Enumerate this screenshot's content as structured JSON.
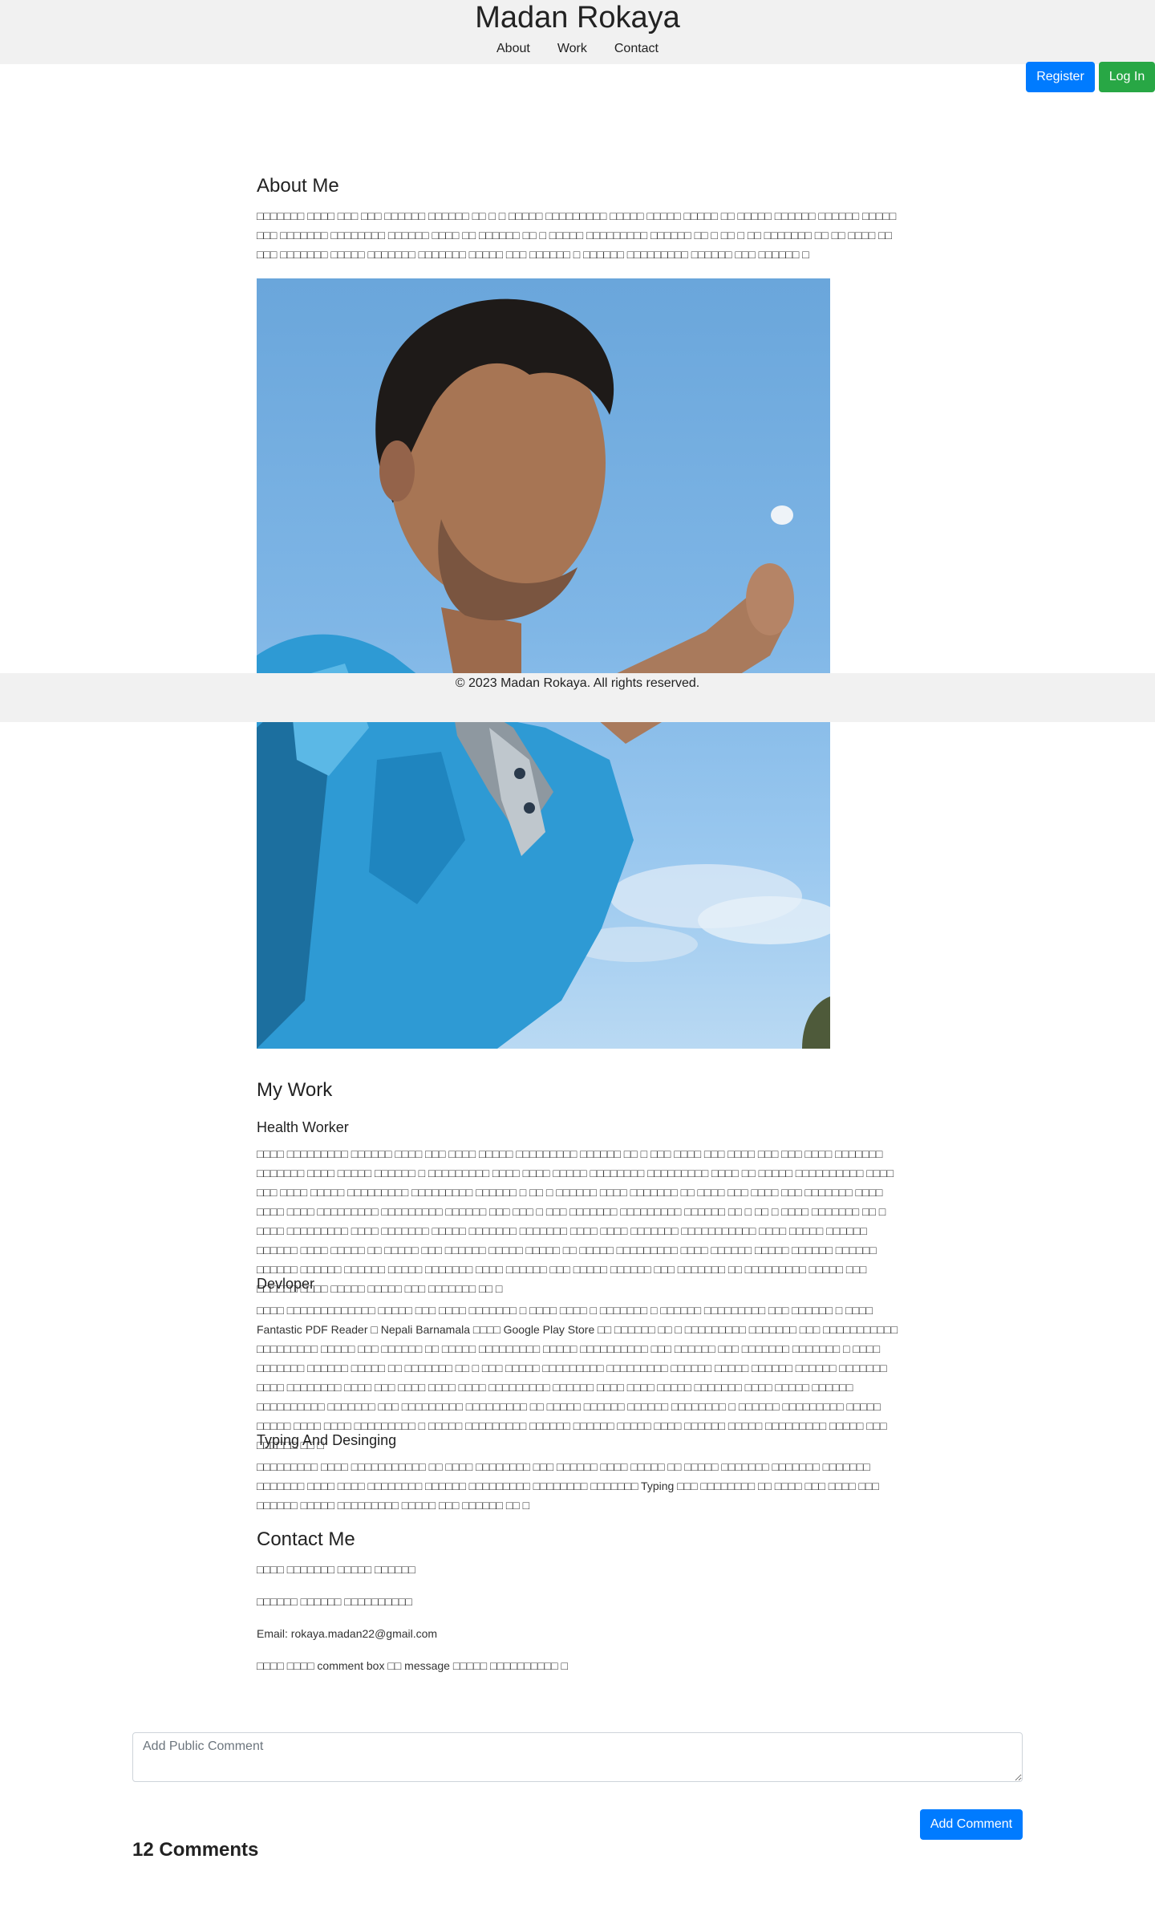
{
  "header": {
    "title": "Madan Rokaya",
    "nav": [
      "About",
      "Work",
      "Contact"
    ]
  },
  "auth": {
    "register": "Register",
    "login": "Log In"
  },
  "about": {
    "heading": "About Me",
    "text": "□□□□□□□ □□□□ □□□ □□□ □□□□□□ □□□□□□ □□ □ □ □□□□□ □□□□□□□□□ □□□□□ □□□□□ □□□□□ □□ □□□□□ □□□□□□ □□□□□□ □□□□□ □□□ □□□□□□□ □□□□□□□□ □□□□□□ □□□□ □□ □□□□□□ □□ □ □□□□□ □□□□□□□□□ □□□□□□ □□ □ □□ □ □□ □□□□□□□ □□ □□ □□□□ □□ □□□ □□□□□□□ □□□□□ □□□□□□□ □□□□□□□ □□□□□ □□□ □□□□□□ □ □□□□□□ □□□□□□□□□ □□□□□□ □□□ □□□□□□ □"
  },
  "work": {
    "heading": "My Work",
    "items": [
      {
        "title": "Health Worker",
        "text": "□□□□ □□□□□□□□□ □□□□□□ □□□□ □□□ □□□□ □□□□□ □□□□□□□□□ □□□□□□ □□ □ □□□ □□□□ □□□ □□□□ □□□ □□□ □□□□ □□□□□□□ □□□□□□□ □□□□ □□□□□ □□□□□□ □ □□□□□□□□□ □□□□ □□□□ □□□□□ □□□□□□□□ □□□□□□□□□ □□□□ □□ □□□□□ □□□□□□□□□□ □□□□ □□□ □□□□ □□□□□ □□□□□□□□□ □□□□□□□□□ □□□□□□ □ □□ □ □□□□□□ □□□□ □□□□□□□ □□ □□□□ □□□ □□□□ □□□ □□□□□□□ □□□□ □□□□ □□□□ □□□□□□□□□ □□□□□□□□□ □□□□□□ □□□ □□□ □ □□□ □□□□□□□ □□□□□□□□□ □□□□□□ □□ □ □□ □ □□□□ □□□□□□□ □□ □ □□□□ □□□□□□□□□ □□□□ □□□□□□□ □□□□□ □□□□□□□ □□□□□□□ □□□□ □□□□ □□□□□□□ □□□□□□□□□□□ □□□□ □□□□□ □□□□□□ □□□□□□ □□□□ □□□□□ □□ □□□□□ □□□ □□□□□□ □□□□□ □□□□□ □□ □□□□□ □□□□□□□□□ □□□□ □□□□□□ □□□□□ □□□□□□ □□□□□□ □□□□□□ □□□□□□ □□□□□□ □□□□□ □□□□□□□ □□□□ □□□□□□ □□□ □□□□□ □□□□□□ □□□ □□□□□□□ □□ □□□□□□□□□ □□□□□ □□□ □□□□□□ □□□□ □□□□□ □□□□□ □□□ □□□□□□□ □□ □"
      },
      {
        "title": "Devloper",
        "text": "□□□□ □□□□□□□□□□□□□ □□□□□ □□□ □□□□ □□□□□□□ □ □□□□ □□□□ □ □□□□□□□ □ □□□□□□ □□□□□□□□□ □□□ □□□□□□ □ □□□□ Fantastic PDF Reader □ Nepali Barnamala □□□□ Google Play Store □□ □□□□□□ □□ □ □□□□□□□□□ □□□□□□□ □□□ □□□□□□□□□□□ □□□□□□□□□ □□□□□ □□□ □□□□□□ □□ □□□□□ □□□□□□□□□ □□□□□ □□□□□□□□□□ □□□ □□□□□□ □□□ □□□□□□□ □□□□□□□ □ □□□□ □□□□□□□ □□□□□□ □□□□□ □□ □□□□□□□ □□ □ □□□ □□□□□ □□□□□□□□□ □□□□□□□□□ □□□□□□ □□□□□ □□□□□□ □□□□□□ □□□□□□□ □□□□ □□□□□□□□ □□□□ □□□ □□□□ □□□□ □□□□ □□□□□□□□□ □□□□□□ □□□□ □□□□ □□□□□ □□□□□□□ □□□□ □□□□□ □□□□□□ □□□□□□□□□□ □□□□□□□ □□□ □□□□□□□□□ □□□□□□□□□ □□ □□□□□ □□□□□□ □□□□□□ □□□□□□□□ □ □□□□□□ □□□□□□□□□ □□□□□ □□□□□ □□□□ □□□□ □□□□□□□□□ □ □□□□□ □□□□□□□□□ □□□□□□ □□□□□□ □□□□□ □□□□ □□□□□□ □□□□□ □□□□□□□□□ □□□□□ □□□ □□□□□□ □□ □"
      },
      {
        "title": "Typing And Desinging",
        "text": "□□□□□□□□□ □□□□ □□□□□□□□□□□ □□ □□□□ □□□□□□□□ □□□ □□□□□□ □□□□ □□□□□ □□ □□□□□ □□□□□□□ □□□□□□□ □□□□□□□ □□□□□□□ □□□□ □□□□ □□□□□□□□ □□□□□□ □□□□□□□□□ □□□□□□□□ □□□□□□□ Typing □□□ □□□□□□□□ □□ □□□□ □□□ □□□□ □□□ □□□□□□ □□□□□ □□□□□□□□□ □□□□□ □□□ □□□□□□ □□ □"
      }
    ]
  },
  "contact": {
    "heading": "Contact Me",
    "line1": "□□□□ □□□□□□□ □□□□□ □□□□□□",
    "line2": "□□□□□□ □□□□□□ □□□□□□□□□□",
    "email": "Email: rokaya.madan22@gmail.com",
    "line4": "□□□□ □□□□ comment box □□ message □□□□□ □□□□□□□□□□ □"
  },
  "footer": {
    "text": "© 2023 Madan Rokaya. All rights reserved."
  },
  "comments": {
    "placeholder": "Add Public Comment",
    "button": "Add Comment",
    "count_label": "12 Comments"
  }
}
